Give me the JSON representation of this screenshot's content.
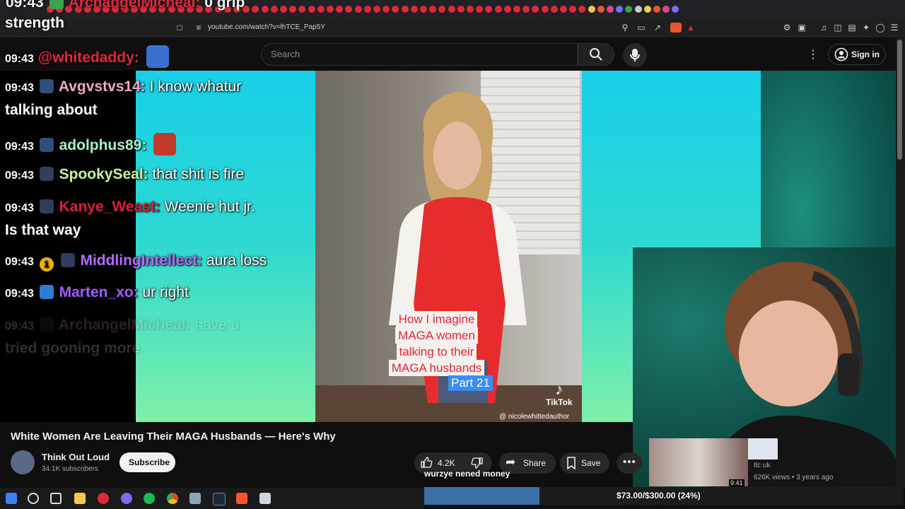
{
  "browser": {
    "url": "youtube.com/watch?v=lhTCE_Pap5Y"
  },
  "youtube": {
    "search_placeholder": "Search",
    "sign_in": "Sign in"
  },
  "video": {
    "title": "White Women Are Leaving Their MAGA Husbands — Here's Why",
    "caption_lines": [
      "How I imagine",
      "MAGA women",
      "talking to their",
      "MAGA husbands"
    ],
    "part_label": "Part 21",
    "tiktok_label": "TikTok",
    "tiktok_user": "@ nicolewhittedauthor"
  },
  "channel": {
    "name": "Think Out Loud",
    "subscribers": "34.1K subscribers",
    "subscribe_label": "Subscribe"
  },
  "actions": {
    "likes": "4.2K",
    "share": "Share",
    "save": "Save"
  },
  "suggestion": {
    "duration": "9:41",
    "channel": "tlc uk",
    "meta": "626K views • 3 years ago"
  },
  "chat": {
    "top_partial": "09:43  ArchangelMicheal: 0 grip",
    "top_partial_time": "09:43",
    "top_partial_user": "ArchangelMicheal:",
    "top_partial_msg": "0 grip",
    "strength": "strength",
    "messages": [
      {
        "time": "09:43",
        "user": "@whitedaddy",
        "sep": ":",
        "msg": "",
        "color": "#e0283a"
      },
      {
        "time": "09:43",
        "user": "Avgvstvs14",
        "sep": ":",
        "msg": "I know whatur",
        "cont": "talking about",
        "color": "#f0a7c8"
      },
      {
        "time": "09:43",
        "user": "adolphus89",
        "sep": ":",
        "msg": "",
        "color": "#a6f0c6"
      },
      {
        "time": "09:43",
        "user": "SpookySeal",
        "sep": ":",
        "msg": "that shit is fire",
        "color": "#c6f59a"
      },
      {
        "time": "09:43",
        "user": "Kanye_Weast",
        "sep": ":",
        "msg": "Weenie hut jr.",
        "cont": "Is that way",
        "color": "#d6203a"
      },
      {
        "time": "09:43",
        "user": "MiddlingIntellect",
        "sep": ":",
        "msg": "aura loss",
        "color": "#b46bff"
      },
      {
        "time": "09:43",
        "user": "Marten_xo",
        "sep": ":",
        "msg": "ur right",
        "color": "#a05cff"
      },
      {
        "time": "09:43",
        "user": "ArchangelMicheal",
        "sep": ":",
        "msg": "have u",
        "cont": "tried gooning more",
        "color": "#f0a7c8"
      }
    ],
    "badge_number": "1"
  },
  "overlay": {
    "tts_text": "wurzye nened money",
    "goal_text": "$73.00/$300.00 (24%)",
    "goal_fraction": 0.24
  },
  "colors": {
    "accent_red": "#e0283a",
    "cyan_bg": "#17cfe9"
  }
}
